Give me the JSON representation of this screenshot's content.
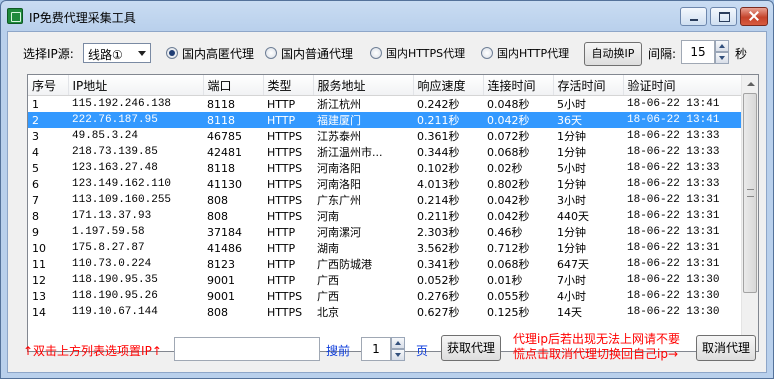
{
  "window": {
    "title": "IP免费代理采集工具"
  },
  "toolbar": {
    "source_label": "选择IP源:",
    "source_value": "线路①",
    "radios": [
      {
        "label": "国内高匿代理",
        "checked": true
      },
      {
        "label": "国内普通代理",
        "checked": false
      },
      {
        "label": "国内HTTPS代理",
        "checked": false
      },
      {
        "label": "国内HTTP代理",
        "checked": false
      }
    ],
    "auto_switch_label": "自动换IP",
    "interval_label": "间隔:",
    "interval_value": "15",
    "interval_unit": "秒"
  },
  "table": {
    "columns": [
      "序号",
      "IP地址",
      "端口",
      "类型",
      "服务地址",
      "响应速度",
      "连接时间",
      "存活时间",
      "验证时间"
    ],
    "selected_index": 1,
    "rows": [
      [
        "1",
        "115.192.246.138",
        "8118",
        "HTTP",
        "浙江杭州",
        "0.242秒",
        "0.048秒",
        "5小时",
        "18-06-22 13:41"
      ],
      [
        "2",
        "222.76.187.95",
        "8118",
        "HTTP",
        "福建厦门",
        "0.211秒",
        "0.042秒",
        "36天",
        "18-06-22 13:41"
      ],
      [
        "3",
        "49.85.3.24",
        "46785",
        "HTTPS",
        "江苏泰州",
        "0.361秒",
        "0.072秒",
        "1分钟",
        "18-06-22 13:33"
      ],
      [
        "4",
        "218.73.139.85",
        "42481",
        "HTTPS",
        "浙江温州市...",
        "0.344秒",
        "0.068秒",
        "1分钟",
        "18-06-22 13:33"
      ],
      [
        "5",
        "123.163.27.48",
        "8118",
        "HTTPS",
        "河南洛阳",
        "0.102秒",
        "0.02秒",
        "5小时",
        "18-06-22 13:33"
      ],
      [
        "6",
        "123.149.162.110",
        "41130",
        "HTTPS",
        "河南洛阳",
        "4.013秒",
        "0.802秒",
        "1分钟",
        "18-06-22 13:33"
      ],
      [
        "7",
        "113.109.160.255",
        "808",
        "HTTPS",
        "广东广州",
        "0.214秒",
        "0.042秒",
        "3小时",
        "18-06-22 13:31"
      ],
      [
        "8",
        "171.13.37.93",
        "808",
        "HTTPS",
        "河南",
        "0.211秒",
        "0.042秒",
        "440天",
        "18-06-22 13:31"
      ],
      [
        "9",
        "1.197.59.58",
        "37184",
        "HTTP",
        "河南漯河",
        "2.303秒",
        "0.46秒",
        "1分钟",
        "18-06-22 13:31"
      ],
      [
        "10",
        "175.8.27.87",
        "41486",
        "HTTP",
        "湖南",
        "3.562秒",
        "0.712秒",
        "1分钟",
        "18-06-22 13:31"
      ],
      [
        "11",
        "110.73.0.224",
        "8123",
        "HTTP",
        "广西防城港",
        "0.341秒",
        "0.068秒",
        "647天",
        "18-06-22 13:31"
      ],
      [
        "12",
        "118.190.95.35",
        "9001",
        "HTTP",
        "广西",
        "0.052秒",
        "0.01秒",
        "7小时",
        "18-06-22 13:30"
      ],
      [
        "13",
        "118.190.95.26",
        "9001",
        "HTTPS",
        "广西",
        "0.276秒",
        "0.055秒",
        "4小时",
        "18-06-22 13:30"
      ],
      [
        "14",
        "119.10.67.144",
        "808",
        "HTTPS",
        "北京",
        "0.627秒",
        "0.125秒",
        "14天",
        "18-06-22 13:30"
      ]
    ]
  },
  "footer": {
    "hint_left": "↑双击上方列表选项置IP↑",
    "ip_input_value": "",
    "search_prev_label": "搜前",
    "page_value": "1",
    "page_unit": "页",
    "get_proxy_label": "获取代理",
    "hint_right_line1": "代理ip后若出现无法上网请不要",
    "hint_right_line2": "慌点击取消代理切换回自己ip→",
    "cancel_proxy_label": "取消代理"
  },
  "colors": {
    "selection": "#3399ff",
    "hint_red": "#ff0000",
    "link_blue": "#0b3bdb"
  }
}
